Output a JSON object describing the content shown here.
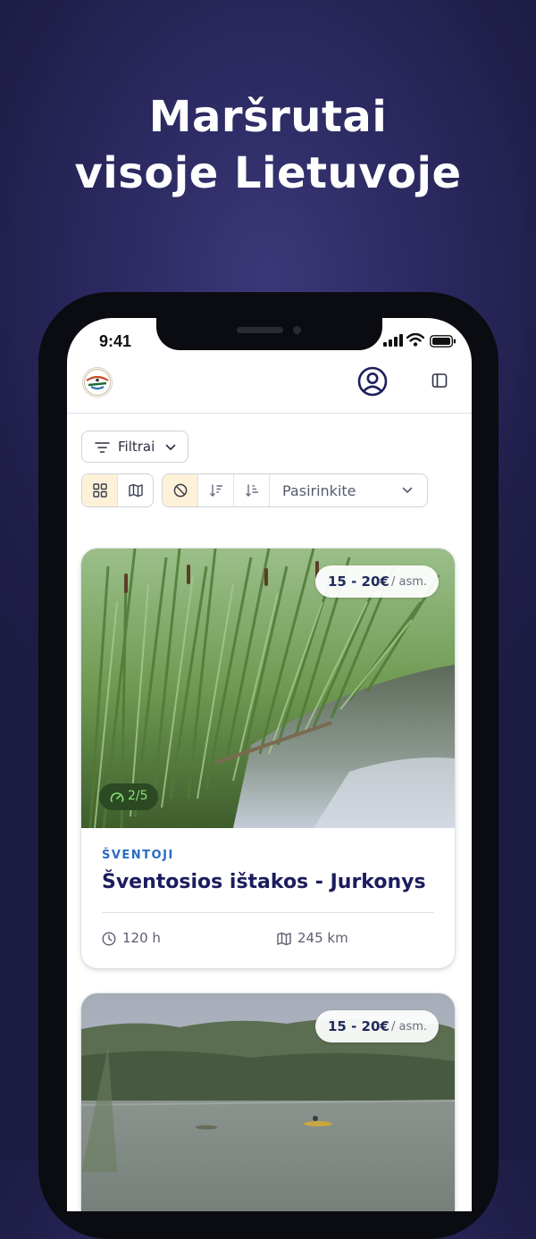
{
  "headline": {
    "line1": "Maršrutai",
    "line2": "visoje Lietuvoje"
  },
  "status_bar": {
    "time": "9:41"
  },
  "toolbar": {
    "filter_label": "Filtrai",
    "sort_placeholder": "Pasirinkite"
  },
  "colors": {
    "background": "#26245a",
    "accent_active": "#fdf2d8",
    "title": "#1c1c5e",
    "region": "#2a6bc4",
    "difficulty_bg": "#2b4a23",
    "difficulty_text": "#8ce07a"
  },
  "routes": [
    {
      "price": "15 - 20€",
      "unit": "/ asm.",
      "difficulty": "2/5",
      "region": "ŠVENTOJI",
      "title": "Šventosios ištakos - Jurkonys",
      "duration": "120 h",
      "distance": "245 km"
    },
    {
      "price": "15 - 20€",
      "unit": "/ asm."
    }
  ]
}
